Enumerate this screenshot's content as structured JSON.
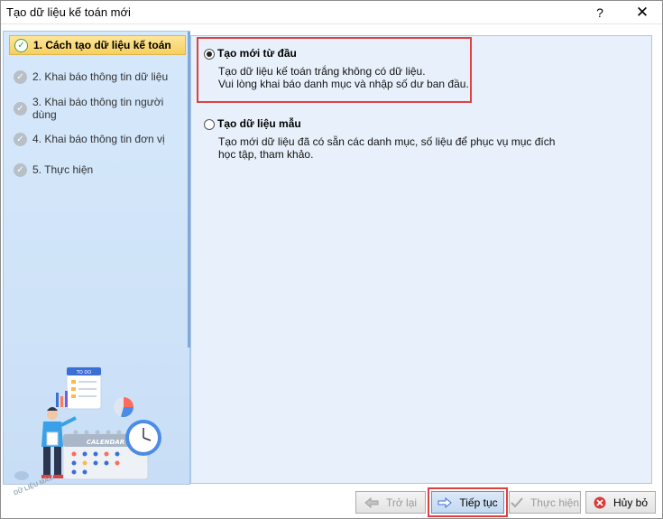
{
  "window": {
    "title": "Tạo dữ liệu kế toán mới",
    "help": "?",
    "close": "✕"
  },
  "steps": [
    {
      "label": "1. Cách tạo dữ liệu kế toán",
      "active": true
    },
    {
      "label": "2. Khai báo thông tin dữ liệu",
      "active": false
    },
    {
      "label": "3. Khai báo thông tin người dùng",
      "active": false
    },
    {
      "label": "4. Khai báo thông tin đơn vị",
      "active": false
    },
    {
      "label": "5. Thực hiện",
      "active": false
    }
  ],
  "options": {
    "new": {
      "title": "Tạo mới từ đầu",
      "desc1": "Tạo dữ liệu kế toán trắng không có dữ liệu.",
      "desc2": "Vui lòng khai báo danh mục và nhập số dư ban đầu.",
      "checked": true
    },
    "sample": {
      "title": "Tạo dữ liệu mẫu",
      "desc": "Tạo mới dữ liệu đã có sẵn các danh mục, số liệu để phục vụ mục đích học tập, tham khảo.",
      "checked": false
    }
  },
  "illustration": {
    "todo": "TO DO",
    "calendar": "CALENDAR",
    "watermark": "DỮ LIỆU MẪU"
  },
  "footer": {
    "back": "Trở lại",
    "next": "Tiếp tục",
    "finish": "Thực hiện",
    "cancel": "Hủy bỏ"
  }
}
